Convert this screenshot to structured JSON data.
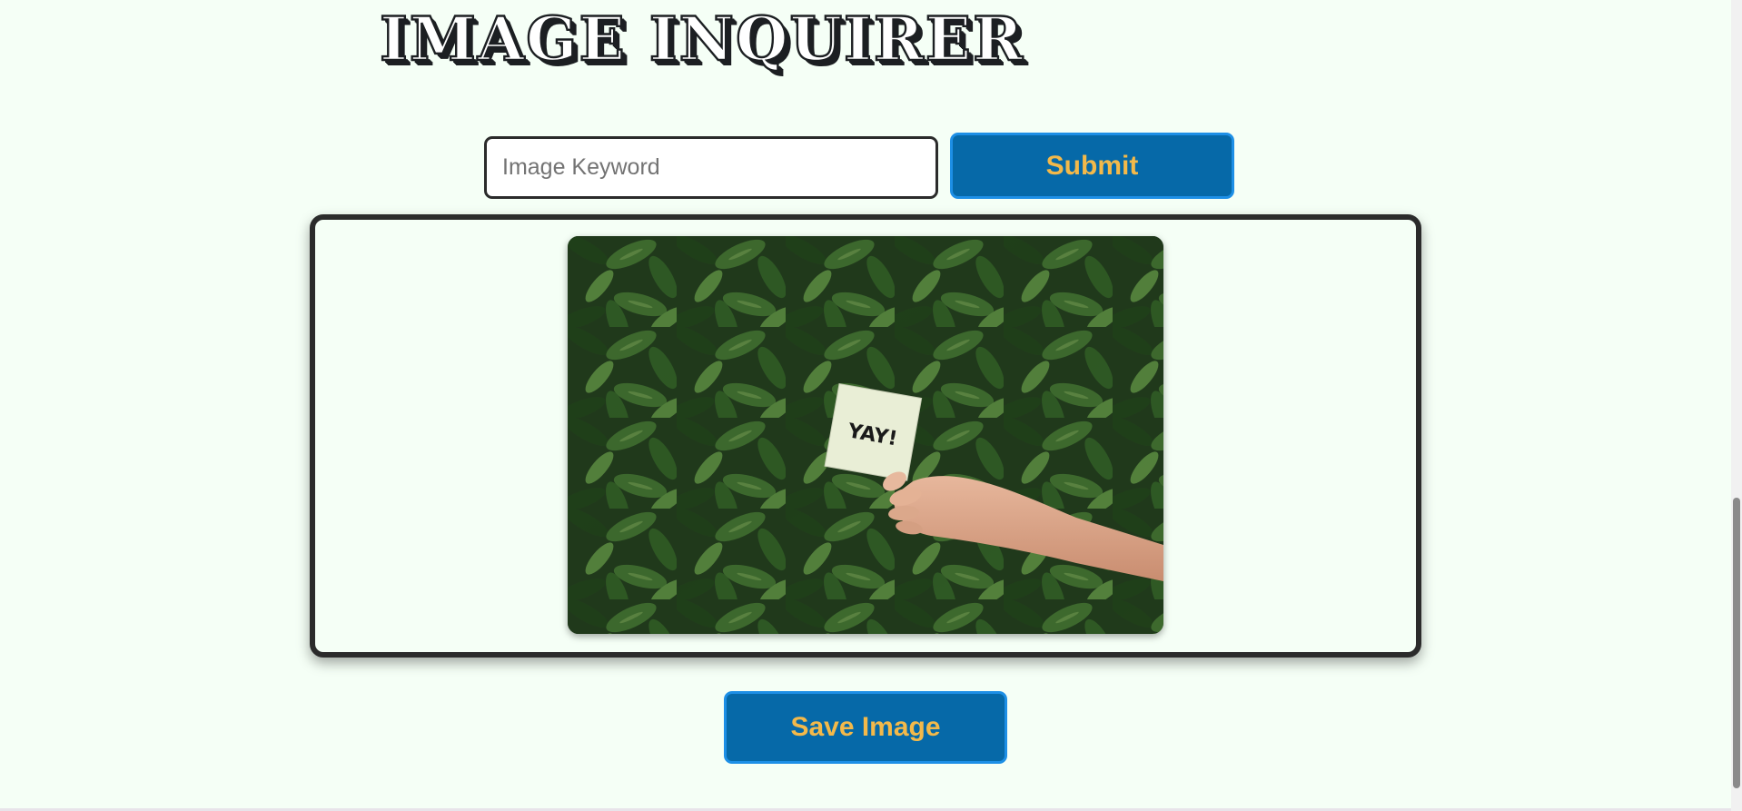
{
  "header": {
    "title": "IMAGE INQUIRER"
  },
  "search": {
    "placeholder": "Image Keyword",
    "value": "",
    "submit_label": "Submit"
  },
  "result": {
    "image_alt": "Hand holding a note that says YAY! in front of green leaves",
    "note_text": "YAY!"
  },
  "actions": {
    "save_label": "Save Image"
  },
  "colors": {
    "background": "#f5fff6",
    "button_bg": "#0669a8",
    "button_border": "#1d8fe6",
    "button_text": "#f3b94a",
    "frame_border": "#2b2b2b"
  }
}
